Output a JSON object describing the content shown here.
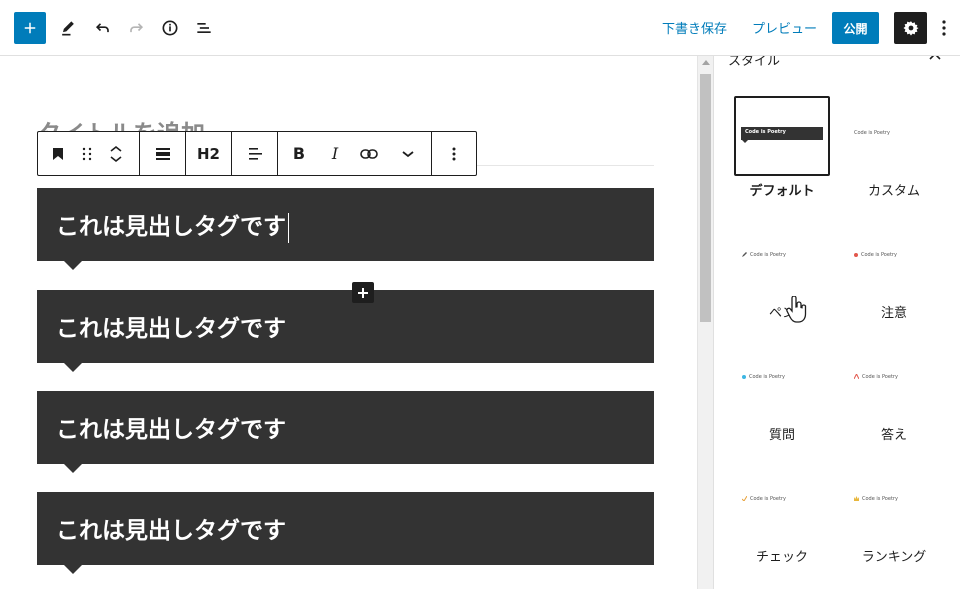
{
  "toolbar": {
    "draft_label": "下書き保存",
    "preview_label": "プレビュー",
    "publish_label": "公開"
  },
  "editor": {
    "title_placeholder": "タイトルを追加",
    "block_toolbar": {
      "heading_level": "H2",
      "bold_label": "B",
      "italic_label": "I"
    },
    "headings": [
      {
        "text": "これは見出しタグです"
      },
      {
        "text": "これは見出しタグです"
      },
      {
        "text": "これは見出しタグです"
      },
      {
        "text": "これは見出しタグです"
      }
    ]
  },
  "sidebar": {
    "panel_title": "スタイル",
    "preview_sample_text": "Code is Poetry",
    "styles": [
      {
        "label": "デフォルト",
        "active": true
      },
      {
        "label": "カスタム",
        "active": false
      },
      {
        "label": "ペン",
        "active": false,
        "mark_color": "#555555"
      },
      {
        "label": "注意",
        "active": false,
        "mark_color": "#e2574c"
      },
      {
        "label": "質問",
        "active": false,
        "mark_color": "#3cb6e3"
      },
      {
        "label": "答え",
        "active": false,
        "mark_color": "#e2574c"
      },
      {
        "label": "チェック",
        "active": false,
        "mark_color": "#e8a33d"
      },
      {
        "label": "ランキング",
        "active": false,
        "mark_color": "#e8b73d"
      }
    ]
  },
  "colors": {
    "accent": "#007cba",
    "heading_bg": "#333333",
    "dark": "#1e1e1e"
  }
}
